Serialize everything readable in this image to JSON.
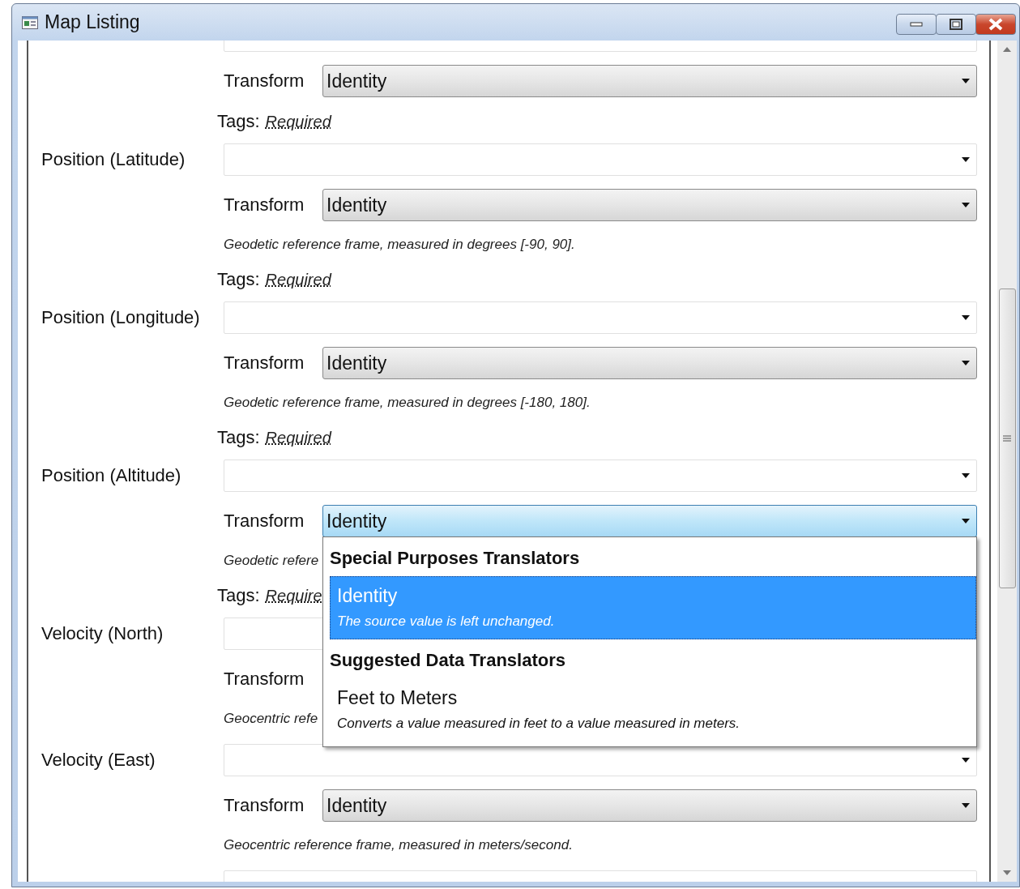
{
  "window": {
    "title": "Map Listing"
  },
  "rows": [
    {
      "kind": "field"
    },
    {
      "kind": "transform",
      "label": "Transform",
      "value": "Identity",
      "open": false
    },
    {
      "kind": "tags",
      "label": "Tags:",
      "value": "Required"
    },
    {
      "kind": "field",
      "label": "Position (Latitude)"
    },
    {
      "kind": "transform",
      "label": "Transform",
      "value": "Identity",
      "open": false
    },
    {
      "kind": "description",
      "text": "Geodetic reference frame, measured in degrees [-90, 90]."
    },
    {
      "kind": "tags",
      "label": "Tags:",
      "value": "Required"
    },
    {
      "kind": "field",
      "label": "Position (Longitude)"
    },
    {
      "kind": "transform",
      "label": "Transform",
      "value": "Identity",
      "open": false
    },
    {
      "kind": "description",
      "text": "Geodetic reference frame, measured in degrees [-180, 180]."
    },
    {
      "kind": "tags",
      "label": "Tags:",
      "value": "Required"
    },
    {
      "kind": "field",
      "label": "Position (Altitude)"
    },
    {
      "kind": "transform",
      "label": "Transform",
      "value": "Identity",
      "open": true,
      "dropdown": {
        "groups": [
          {
            "heading": "Special Purposes Translators",
            "items": [
              {
                "name": "Identity",
                "description": "The source value is left unchanged.",
                "selected": true
              }
            ]
          },
          {
            "heading": "Suggested Data Translators",
            "items": [
              {
                "name": "Feet to Meters",
                "description": "Converts a value measured in feet to a value measured in meters.",
                "selected": false
              }
            ]
          }
        ]
      }
    },
    {
      "kind": "description",
      "text": "Geodetic refere"
    },
    {
      "kind": "tags",
      "label": "Tags:",
      "value": "Require"
    },
    {
      "kind": "field",
      "label": "Velocity (North)"
    },
    {
      "kind": "transform",
      "label": "Transform"
    },
    {
      "kind": "description",
      "text": "Geocentric refe"
    },
    {
      "kind": "field",
      "label": "Velocity (East)"
    },
    {
      "kind": "transform",
      "label": "Transform",
      "value": "Identity",
      "open": false
    },
    {
      "kind": "description",
      "text": "Geocentric reference frame, measured in meters/second."
    },
    {
      "kind": "field"
    }
  ]
}
